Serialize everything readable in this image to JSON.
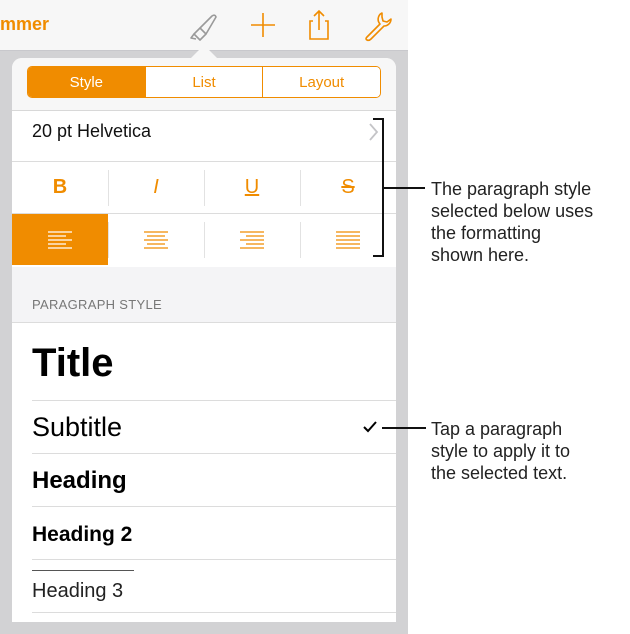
{
  "app": {
    "doc_title": "mmer"
  },
  "toolbar": {
    "icons": [
      "paintbrush-icon",
      "plus-icon",
      "share-icon",
      "wrench-icon"
    ],
    "accent": "#f08c00"
  },
  "tabs": [
    {
      "label": "Style",
      "active": true
    },
    {
      "label": "List",
      "active": false
    },
    {
      "label": "Layout",
      "active": false
    }
  ],
  "font": {
    "name": "20 pt Helvetica"
  },
  "format_buttons": [
    "B",
    "I",
    "U",
    "S"
  ],
  "alignment": {
    "options": [
      "align-left",
      "align-center",
      "align-right",
      "align-justify"
    ],
    "selected": "align-left"
  },
  "paragraph_style": {
    "section_label": "PARAGRAPH STYLE",
    "items": [
      {
        "label": "Title"
      },
      {
        "label": "Subtitle",
        "checked": true
      },
      {
        "label": "Heading"
      },
      {
        "label": "Heading 2"
      },
      {
        "label": "Heading 3"
      }
    ]
  },
  "callouts": {
    "first": [
      "The paragraph style",
      "selected below uses",
      "the formatting",
      "shown here."
    ],
    "second": [
      "Tap a paragraph",
      "style to apply it to",
      "the selected text."
    ]
  }
}
